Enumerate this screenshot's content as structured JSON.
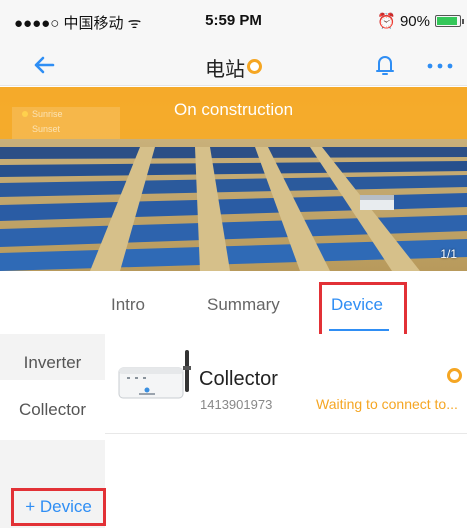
{
  "status_bar": {
    "carrier": "●●●●○ 中国移动 ᯤ",
    "time": "5:59 PM",
    "battery": "⏰ 90%"
  },
  "nav": {
    "title": "电站",
    "back_icon": "arrow-left-icon",
    "bell_icon": "bell-icon",
    "more_icon": "more-icon"
  },
  "hero": {
    "status_text": "On construction",
    "sunrise_label": "Sunrise",
    "sunset_label": "Sunset",
    "pager": "1/1"
  },
  "tabs": {
    "intro": "Intro",
    "summary": "Summary",
    "device": "Device",
    "active": "Device"
  },
  "sidebar": {
    "inverter": "Inverter",
    "collector": "Collector",
    "add_device": "+ Device"
  },
  "devices": [
    {
      "name": "Collector",
      "serial": "1413901973",
      "status": "Waiting to connect to..."
    }
  ],
  "colors": {
    "accent": "#2f8ef4",
    "warning": "#f5a623",
    "highlight": "#e23136"
  }
}
